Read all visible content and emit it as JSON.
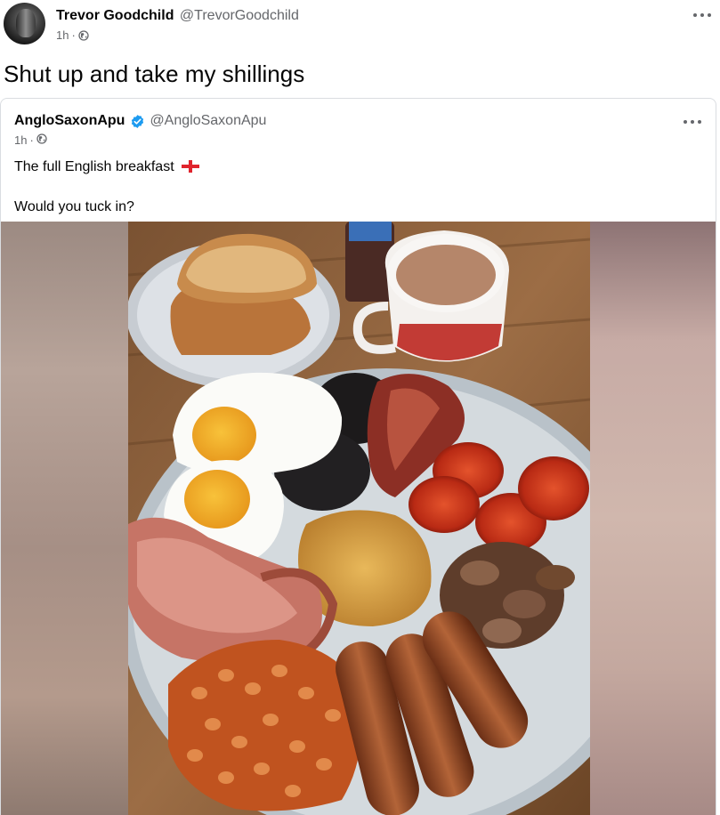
{
  "post": {
    "author_name": "Trevor Goodchild",
    "author_handle": "@TrevorGoodchild",
    "time": "1h",
    "separator": "·",
    "text": "Shut up and take my shillings"
  },
  "quoted": {
    "author_name": "AngloSaxonApu",
    "author_handle": "@AngloSaxonApu",
    "verified": true,
    "time": "1h",
    "separator": "·",
    "text_line1": "The full English breakfast",
    "text_line2": "Would you tuck in?"
  },
  "icons": {
    "more": "more-horizontal-icon",
    "globe": "globe-icon",
    "verified": "verified-badge-icon",
    "flag": "england-flag-icon"
  },
  "colors": {
    "text": "#050505",
    "secondary": "#65676b",
    "verified_blue": "#1d9bf0",
    "border": "#dadde1",
    "flag_red": "#e0242d"
  }
}
